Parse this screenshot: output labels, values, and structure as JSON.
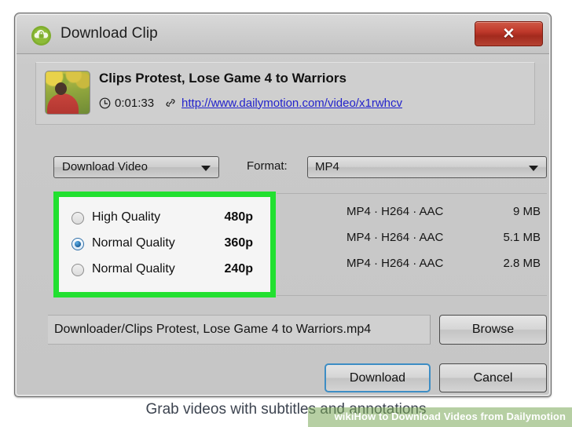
{
  "window": {
    "title": "Download Clip",
    "app_icon": "download-cloud-icon",
    "close_label": "✕"
  },
  "video": {
    "title": "Clips Protest, Lose Game 4 to Warriors",
    "duration": "0:01:33",
    "url": "http://www.dailymotion.com/video/x1rwhcv",
    "clock_icon": "clock-icon",
    "link_icon": "link-icon",
    "thumbnail_alt": "video-thumbnail"
  },
  "controls": {
    "mode_selected": "Download Video",
    "format_label": "Format:",
    "format_selected": "MP4"
  },
  "quality": {
    "selected_index": 1,
    "rows": [
      {
        "label": "High Quality",
        "resolution": "480p",
        "codec": "MP4 · H264 · AAC",
        "size": "9 MB",
        "checked": false
      },
      {
        "label": "Normal Quality",
        "resolution": "360p",
        "codec": "MP4 · H264 · AAC",
        "size": "5.1 MB",
        "checked": true
      },
      {
        "label": "Normal Quality",
        "resolution": "240p",
        "codec": "MP4 · H264 · AAC",
        "size": "2.8 MB",
        "checked": false
      }
    ]
  },
  "save": {
    "path_value": "Downloader/Clips Protest, Lose Game 4 to Warriors.mp4",
    "browse_label": "Browse"
  },
  "actions": {
    "download_label": "Download",
    "cancel_label": "Cancel"
  },
  "footer": {
    "caption": "Grab videos with subtitles and annotations",
    "watermark": "wikiHow to Download Videos from Dailymotion"
  },
  "colors": {
    "highlight_green": "#22e030",
    "close_red": "#c0392b",
    "link_blue": "#2222cc",
    "focus_blue": "#3d8dc4",
    "watermark_green": "#7aa858"
  }
}
